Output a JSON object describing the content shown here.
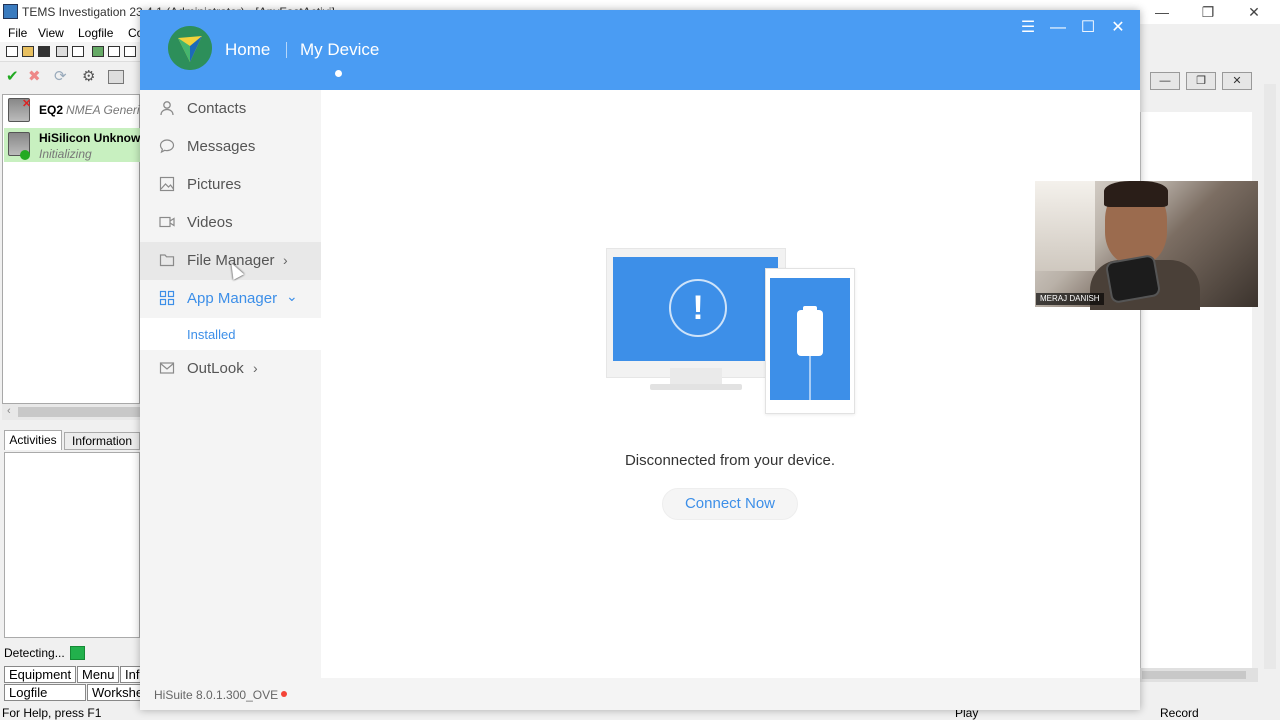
{
  "tems": {
    "title": "TEMS Investigation 23.4.1 (Administrator) - [AnyFastActivi]",
    "menu": [
      "File",
      "View",
      "Logfile",
      "Co"
    ],
    "equipment": [
      {
        "name": "EQ2",
        "sub": "NMEA Generic"
      },
      {
        "name": "HiSilicon Unknown",
        "sub": "Initializing"
      }
    ],
    "tabs": {
      "activities": "Activities",
      "information": "Information"
    },
    "detecting": "Detecting...",
    "bottom_tabs": {
      "equipment": "Equipment",
      "menu": "Menu",
      "info": "Info",
      "logfile": "Logfile",
      "worksheet": "Worksheet"
    },
    "status": {
      "help": "For Help, press F1",
      "play": "Play",
      "record": "Record"
    },
    "colors": {
      "detect": "#22b14c"
    }
  },
  "hisuite": {
    "nav": {
      "home": "Home",
      "my_device": "My Device"
    },
    "sidebar": [
      {
        "label": "Contacts",
        "icon": "person-icon"
      },
      {
        "label": "Messages",
        "icon": "chat-bubble-icon"
      },
      {
        "label": "Pictures",
        "icon": "picture-icon"
      },
      {
        "label": "Videos",
        "icon": "video-icon"
      },
      {
        "label": "File Manager",
        "icon": "folder-icon"
      },
      {
        "label": "App Manager",
        "icon": "grid-icon"
      },
      {
        "label": "Installed"
      },
      {
        "label": "OutLook",
        "icon": "mail-icon"
      }
    ],
    "message": "Disconnected from your device.",
    "connect_button": "Connect Now",
    "version": "HiSuite 8.0.1.300_OVE",
    "colors": {
      "header": "#4a9cf3",
      "accent": "#3d8fe8"
    }
  },
  "webcam": {
    "name": "MERAJ DANISH"
  }
}
